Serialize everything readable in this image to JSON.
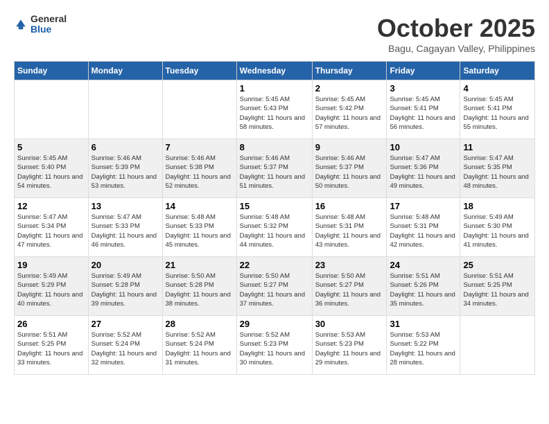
{
  "header": {
    "logo": {
      "line1": "General",
      "line2": "Blue"
    },
    "title": "October 2025",
    "location": "Bagu, Cagayan Valley, Philippines"
  },
  "weekdays": [
    "Sunday",
    "Monday",
    "Tuesday",
    "Wednesday",
    "Thursday",
    "Friday",
    "Saturday"
  ],
  "weeks": [
    [
      {
        "day": "",
        "sunrise": "",
        "sunset": "",
        "daylight": ""
      },
      {
        "day": "",
        "sunrise": "",
        "sunset": "",
        "daylight": ""
      },
      {
        "day": "",
        "sunrise": "",
        "sunset": "",
        "daylight": ""
      },
      {
        "day": "1",
        "sunrise": "Sunrise: 5:45 AM",
        "sunset": "Sunset: 5:43 PM",
        "daylight": "Daylight: 11 hours and 58 minutes."
      },
      {
        "day": "2",
        "sunrise": "Sunrise: 5:45 AM",
        "sunset": "Sunset: 5:42 PM",
        "daylight": "Daylight: 11 hours and 57 minutes."
      },
      {
        "day": "3",
        "sunrise": "Sunrise: 5:45 AM",
        "sunset": "Sunset: 5:41 PM",
        "daylight": "Daylight: 11 hours and 56 minutes."
      },
      {
        "day": "4",
        "sunrise": "Sunrise: 5:45 AM",
        "sunset": "Sunset: 5:41 PM",
        "daylight": "Daylight: 11 hours and 55 minutes."
      }
    ],
    [
      {
        "day": "5",
        "sunrise": "Sunrise: 5:45 AM",
        "sunset": "Sunset: 5:40 PM",
        "daylight": "Daylight: 11 hours and 54 minutes."
      },
      {
        "day": "6",
        "sunrise": "Sunrise: 5:46 AM",
        "sunset": "Sunset: 5:39 PM",
        "daylight": "Daylight: 11 hours and 53 minutes."
      },
      {
        "day": "7",
        "sunrise": "Sunrise: 5:46 AM",
        "sunset": "Sunset: 5:38 PM",
        "daylight": "Daylight: 11 hours and 52 minutes."
      },
      {
        "day": "8",
        "sunrise": "Sunrise: 5:46 AM",
        "sunset": "Sunset: 5:37 PM",
        "daylight": "Daylight: 11 hours and 51 minutes."
      },
      {
        "day": "9",
        "sunrise": "Sunrise: 5:46 AM",
        "sunset": "Sunset: 5:37 PM",
        "daylight": "Daylight: 11 hours and 50 minutes."
      },
      {
        "day": "10",
        "sunrise": "Sunrise: 5:47 AM",
        "sunset": "Sunset: 5:36 PM",
        "daylight": "Daylight: 11 hours and 49 minutes."
      },
      {
        "day": "11",
        "sunrise": "Sunrise: 5:47 AM",
        "sunset": "Sunset: 5:35 PM",
        "daylight": "Daylight: 11 hours and 48 minutes."
      }
    ],
    [
      {
        "day": "12",
        "sunrise": "Sunrise: 5:47 AM",
        "sunset": "Sunset: 5:34 PM",
        "daylight": "Daylight: 11 hours and 47 minutes."
      },
      {
        "day": "13",
        "sunrise": "Sunrise: 5:47 AM",
        "sunset": "Sunset: 5:33 PM",
        "daylight": "Daylight: 11 hours and 46 minutes."
      },
      {
        "day": "14",
        "sunrise": "Sunrise: 5:48 AM",
        "sunset": "Sunset: 5:33 PM",
        "daylight": "Daylight: 11 hours and 45 minutes."
      },
      {
        "day": "15",
        "sunrise": "Sunrise: 5:48 AM",
        "sunset": "Sunset: 5:32 PM",
        "daylight": "Daylight: 11 hours and 44 minutes."
      },
      {
        "day": "16",
        "sunrise": "Sunrise: 5:48 AM",
        "sunset": "Sunset: 5:31 PM",
        "daylight": "Daylight: 11 hours and 43 minutes."
      },
      {
        "day": "17",
        "sunrise": "Sunrise: 5:48 AM",
        "sunset": "Sunset: 5:31 PM",
        "daylight": "Daylight: 11 hours and 42 minutes."
      },
      {
        "day": "18",
        "sunrise": "Sunrise: 5:49 AM",
        "sunset": "Sunset: 5:30 PM",
        "daylight": "Daylight: 11 hours and 41 minutes."
      }
    ],
    [
      {
        "day": "19",
        "sunrise": "Sunrise: 5:49 AM",
        "sunset": "Sunset: 5:29 PM",
        "daylight": "Daylight: 11 hours and 40 minutes."
      },
      {
        "day": "20",
        "sunrise": "Sunrise: 5:49 AM",
        "sunset": "Sunset: 5:28 PM",
        "daylight": "Daylight: 11 hours and 39 minutes."
      },
      {
        "day": "21",
        "sunrise": "Sunrise: 5:50 AM",
        "sunset": "Sunset: 5:28 PM",
        "daylight": "Daylight: 11 hours and 38 minutes."
      },
      {
        "day": "22",
        "sunrise": "Sunrise: 5:50 AM",
        "sunset": "Sunset: 5:27 PM",
        "daylight": "Daylight: 11 hours and 37 minutes."
      },
      {
        "day": "23",
        "sunrise": "Sunrise: 5:50 AM",
        "sunset": "Sunset: 5:27 PM",
        "daylight": "Daylight: 11 hours and 36 minutes."
      },
      {
        "day": "24",
        "sunrise": "Sunrise: 5:51 AM",
        "sunset": "Sunset: 5:26 PM",
        "daylight": "Daylight: 11 hours and 35 minutes."
      },
      {
        "day": "25",
        "sunrise": "Sunrise: 5:51 AM",
        "sunset": "Sunset: 5:25 PM",
        "daylight": "Daylight: 11 hours and 34 minutes."
      }
    ],
    [
      {
        "day": "26",
        "sunrise": "Sunrise: 5:51 AM",
        "sunset": "Sunset: 5:25 PM",
        "daylight": "Daylight: 11 hours and 33 minutes."
      },
      {
        "day": "27",
        "sunrise": "Sunrise: 5:52 AM",
        "sunset": "Sunset: 5:24 PM",
        "daylight": "Daylight: 11 hours and 32 minutes."
      },
      {
        "day": "28",
        "sunrise": "Sunrise: 5:52 AM",
        "sunset": "Sunset: 5:24 PM",
        "daylight": "Daylight: 11 hours and 31 minutes."
      },
      {
        "day": "29",
        "sunrise": "Sunrise: 5:52 AM",
        "sunset": "Sunset: 5:23 PM",
        "daylight": "Daylight: 11 hours and 30 minutes."
      },
      {
        "day": "30",
        "sunrise": "Sunrise: 5:53 AM",
        "sunset": "Sunset: 5:23 PM",
        "daylight": "Daylight: 11 hours and 29 minutes."
      },
      {
        "day": "31",
        "sunrise": "Sunrise: 5:53 AM",
        "sunset": "Sunset: 5:22 PM",
        "daylight": "Daylight: 11 hours and 28 minutes."
      },
      {
        "day": "",
        "sunrise": "",
        "sunset": "",
        "daylight": ""
      }
    ]
  ]
}
